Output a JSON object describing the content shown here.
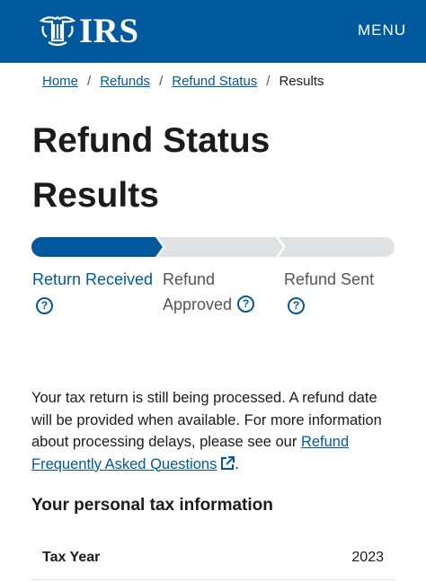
{
  "header": {
    "logo_text": "IRS",
    "menu_label": "MENU",
    "brand_color": "#00599c"
  },
  "breadcrumb": {
    "items": [
      {
        "label": "Home"
      },
      {
        "label": "Refunds"
      },
      {
        "label": "Refund Status"
      },
      {
        "label": "Results"
      }
    ],
    "separator": "/"
  },
  "page": {
    "title_line1": "Refund Status",
    "title_line2": "Results"
  },
  "progress": {
    "current_step": 1,
    "total_steps": 3,
    "active_color": "#00599c",
    "inactive_color": "#dfe1e2",
    "steps": [
      {
        "label_line1": "Return Received",
        "label_line2": "",
        "help_icon": "question-circle-icon"
      },
      {
        "label_line1": "Refund",
        "label_line2": "Approved",
        "help_icon": "question-circle-icon"
      },
      {
        "label_line1": "Refund Sent",
        "label_line2": "",
        "help_icon": "question-circle-icon"
      }
    ],
    "help_glyph": "?"
  },
  "message": {
    "text": "Your tax return is still being processed. A refund date will be provided when available. For more information about processing delays, please see our ",
    "link_text": "Refund Frequently Asked Questions",
    "link_icon": "external-link-icon",
    "trailing": "."
  },
  "personal_info": {
    "heading": "Your personal tax information",
    "rows": [
      {
        "label": "Tax Year",
        "value": "2023"
      }
    ]
  }
}
